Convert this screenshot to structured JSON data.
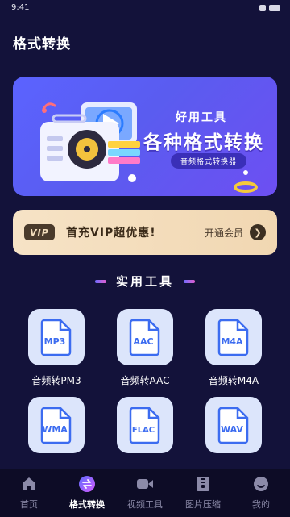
{
  "status_bar": {
    "time": "9:41"
  },
  "header": {
    "title": "格式转换"
  },
  "banner": {
    "kicker": "好用工具",
    "headline": "各种格式转换",
    "pill": "音频格式转换器"
  },
  "vip": {
    "badge": "VIP",
    "text": "首充VIP超优惠!",
    "cta": "开通会员",
    "arrow": "❯"
  },
  "section": {
    "title": "实用工具"
  },
  "tools": [
    {
      "format": "MP3",
      "label": "音频转PM3"
    },
    {
      "format": "AAC",
      "label": "音频转AAC"
    },
    {
      "format": "M4A",
      "label": "音频转M4A"
    },
    {
      "format": "WMA",
      "label": ""
    },
    {
      "format": "FLAC",
      "label": ""
    },
    {
      "format": "WAV",
      "label": ""
    }
  ],
  "tabbar": [
    {
      "label": "首页",
      "icon": "home-icon",
      "active": false
    },
    {
      "label": "格式转换",
      "icon": "convert-icon",
      "active": true
    },
    {
      "label": "视频工具",
      "icon": "video-camera-icon",
      "active": false
    },
    {
      "label": "图片压缩",
      "icon": "image-compress-icon",
      "active": false
    },
    {
      "label": "我的",
      "icon": "profile-icon",
      "active": false
    }
  ],
  "colors": {
    "background": "#13123a",
    "banner": "#5b63ff",
    "vip": "#f3dcbc",
    "tool_card": "#dce5fb",
    "tool_accent": "#3c6cf0"
  }
}
